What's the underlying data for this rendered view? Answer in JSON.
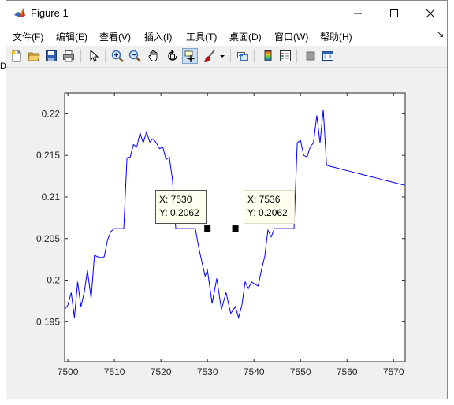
{
  "window": {
    "title": "Figure 1",
    "controls": [
      "minimize",
      "maximize",
      "close"
    ]
  },
  "background": {
    "fragment": "Da"
  },
  "menu": {
    "items": [
      {
        "label": "文件(F)"
      },
      {
        "label": "编辑(E)"
      },
      {
        "label": "查看(V)"
      },
      {
        "label": "插入(I)"
      },
      {
        "label": "工具(T)"
      },
      {
        "label": "桌面(D)"
      },
      {
        "label": "窗口(W)"
      },
      {
        "label": "帮助(H)"
      }
    ],
    "overflow_icon": "dock-arrow-icon"
  },
  "toolbar": {
    "icons": [
      "new-figure-icon",
      "open-file-icon",
      "save-icon",
      "print-icon",
      "edit-plot-arrow-icon",
      "zoom-in-icon",
      "zoom-out-icon",
      "pan-hand-icon",
      "rotate-3d-icon",
      "data-cursor-icon",
      "brush-icon",
      "brush-dropdown-icon",
      "link-plot-icon",
      "colorbar-icon",
      "legend-icon",
      "hide-plot-tools-icon",
      "show-plot-tools-icon"
    ],
    "active": "data-cursor-icon"
  },
  "colors": {
    "line": "#0000ff",
    "marker": "#000000",
    "tip_bg": "#ffffee"
  },
  "chart_data": {
    "type": "line",
    "xlabel": "",
    "ylabel": "",
    "title": "",
    "xlim": [
      7499.3,
      7572.5
    ],
    "ylim": [
      0.1902,
      0.2225
    ],
    "xticks": [
      7500,
      7510,
      7520,
      7530,
      7540,
      7550,
      7560,
      7570
    ],
    "yticks": [
      0.195,
      0.2,
      0.205,
      0.21,
      0.215,
      0.22
    ],
    "xtick_labels": [
      "7500",
      "7510",
      "7520",
      "7530",
      "7540",
      "7550",
      "7560",
      "7570"
    ],
    "ytick_labels": [
      "0.195",
      "0.2",
      "0.205",
      "0.21",
      "0.215",
      "0.22"
    ],
    "grid": false,
    "series": [
      {
        "x": [
          7499.3,
          7500,
          7500.7,
          7501.4,
          7502.1,
          7502.8,
          7503.5,
          7504.2,
          7505.0,
          7505.7,
          7506.4,
          7507.1,
          7507.8,
          7508.5,
          7509.2,
          7509.9,
          7510.6,
          7511.3,
          7512.0,
          7512.7,
          7513.4,
          7514.1,
          7514.8,
          7515.5,
          7516.2,
          7516.9,
          7517.6,
          7518.3,
          7519.0,
          7519.7,
          7520.4,
          7521.1,
          7521.8,
          7522.5,
          7523.2,
          7523.9,
          7524.6,
          7525.3,
          7526.0,
          7526.7,
          7527.4,
          7528.1,
          7528.8,
          7529.5,
          7530,
          7531,
          7532,
          7533,
          7534,
          7535,
          7536,
          7536.7,
          7537.4,
          7538.1,
          7538.8,
          7539.5,
          7540.2,
          7540.9,
          7541.6,
          7542.3,
          7543.0,
          7543.7,
          7544.4,
          7545.1,
          7545.8,
          7546.5,
          7547.2,
          7547.9,
          7548.6,
          7549.3,
          7550.0,
          7550.7,
          7551.4,
          7552.1,
          7552.8,
          7553.5,
          7554.2,
          7554.9,
          7555.6,
          7556.3,
          7557.0,
          7557.7,
          7558.4,
          7559.1,
          7559.8,
          7560.5,
          7561.2,
          7561.9,
          7562.6,
          7563.3,
          7564.0,
          7564.7,
          7565.4,
          7566.1,
          7566.8,
          7567.5,
          7568.2,
          7568.9,
          7569.6,
          7570.3,
          7571.0,
          7571.7,
          7572.4
        ],
        "y": [
          0.1965,
          0.197,
          0.1985,
          0.1955,
          0.1998,
          0.1968,
          0.1985,
          0.2012,
          0.1978,
          0.203,
          0.2028,
          0.2027,
          0.2028,
          0.2048,
          0.2058,
          0.2062,
          0.2062,
          0.2062,
          0.2062,
          0.2147,
          0.2148,
          0.2163,
          0.216,
          0.2177,
          0.2165,
          0.2178,
          0.2166,
          0.217,
          0.2165,
          0.2158,
          0.216,
          0.2145,
          0.2148,
          0.212,
          0.2062,
          0.2062,
          0.2062,
          0.2062,
          0.2062,
          0.2062,
          0.2062,
          0.204,
          0.2022,
          0.2005,
          0.2012,
          0.1972,
          0.2002,
          0.1965,
          0.1985,
          0.196,
          0.1968,
          0.1955,
          0.197,
          0.1998,
          0.199,
          0.1998,
          0.1995,
          0.1993,
          0.2012,
          0.2028,
          0.206,
          0.2052,
          0.2062,
          0.2062,
          0.2062,
          0.2062,
          0.2062,
          0.2062,
          0.2062,
          0.2165,
          0.2168,
          0.215,
          0.2148,
          0.216,
          0.2165,
          0.2198,
          0.2165,
          0.2205,
          0.2138,
          0.2137,
          0.2136,
          0.2135,
          0.2134,
          0.2133,
          0.2132,
          0.2131,
          0.213,
          0.2129,
          0.2128,
          0.2127,
          0.2126,
          0.2125,
          0.2124,
          0.2123,
          0.2122,
          0.2121,
          0.212,
          0.2119,
          0.2118,
          0.2117,
          0.2116,
          0.2115,
          0.2114
        ]
      }
    ],
    "datatips": [
      {
        "x": 7530,
        "y": 0.2062,
        "x_label": "X: 7530",
        "y_label": "Y: 0.2062"
      },
      {
        "x": 7536,
        "y": 0.2062,
        "x_label": "X: 7536",
        "y_label": "Y: 0.2062"
      }
    ]
  }
}
